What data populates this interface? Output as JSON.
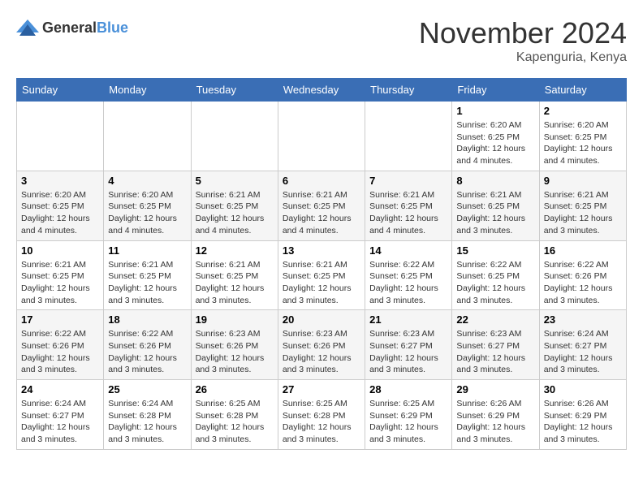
{
  "logo": {
    "general": "General",
    "blue": "Blue"
  },
  "header": {
    "month": "November 2024",
    "location": "Kapenguria, Kenya"
  },
  "weekdays": [
    "Sunday",
    "Monday",
    "Tuesday",
    "Wednesday",
    "Thursday",
    "Friday",
    "Saturday"
  ],
  "weeks": [
    [
      {
        "day": "",
        "info": ""
      },
      {
        "day": "",
        "info": ""
      },
      {
        "day": "",
        "info": ""
      },
      {
        "day": "",
        "info": ""
      },
      {
        "day": "",
        "info": ""
      },
      {
        "day": "1",
        "info": "Sunrise: 6:20 AM\nSunset: 6:25 PM\nDaylight: 12 hours and 4 minutes."
      },
      {
        "day": "2",
        "info": "Sunrise: 6:20 AM\nSunset: 6:25 PM\nDaylight: 12 hours and 4 minutes."
      }
    ],
    [
      {
        "day": "3",
        "info": "Sunrise: 6:20 AM\nSunset: 6:25 PM\nDaylight: 12 hours and 4 minutes."
      },
      {
        "day": "4",
        "info": "Sunrise: 6:20 AM\nSunset: 6:25 PM\nDaylight: 12 hours and 4 minutes."
      },
      {
        "day": "5",
        "info": "Sunrise: 6:21 AM\nSunset: 6:25 PM\nDaylight: 12 hours and 4 minutes."
      },
      {
        "day": "6",
        "info": "Sunrise: 6:21 AM\nSunset: 6:25 PM\nDaylight: 12 hours and 4 minutes."
      },
      {
        "day": "7",
        "info": "Sunrise: 6:21 AM\nSunset: 6:25 PM\nDaylight: 12 hours and 4 minutes."
      },
      {
        "day": "8",
        "info": "Sunrise: 6:21 AM\nSunset: 6:25 PM\nDaylight: 12 hours and 3 minutes."
      },
      {
        "day": "9",
        "info": "Sunrise: 6:21 AM\nSunset: 6:25 PM\nDaylight: 12 hours and 3 minutes."
      }
    ],
    [
      {
        "day": "10",
        "info": "Sunrise: 6:21 AM\nSunset: 6:25 PM\nDaylight: 12 hours and 3 minutes."
      },
      {
        "day": "11",
        "info": "Sunrise: 6:21 AM\nSunset: 6:25 PM\nDaylight: 12 hours and 3 minutes."
      },
      {
        "day": "12",
        "info": "Sunrise: 6:21 AM\nSunset: 6:25 PM\nDaylight: 12 hours and 3 minutes."
      },
      {
        "day": "13",
        "info": "Sunrise: 6:21 AM\nSunset: 6:25 PM\nDaylight: 12 hours and 3 minutes."
      },
      {
        "day": "14",
        "info": "Sunrise: 6:22 AM\nSunset: 6:25 PM\nDaylight: 12 hours and 3 minutes."
      },
      {
        "day": "15",
        "info": "Sunrise: 6:22 AM\nSunset: 6:25 PM\nDaylight: 12 hours and 3 minutes."
      },
      {
        "day": "16",
        "info": "Sunrise: 6:22 AM\nSunset: 6:26 PM\nDaylight: 12 hours and 3 minutes."
      }
    ],
    [
      {
        "day": "17",
        "info": "Sunrise: 6:22 AM\nSunset: 6:26 PM\nDaylight: 12 hours and 3 minutes."
      },
      {
        "day": "18",
        "info": "Sunrise: 6:22 AM\nSunset: 6:26 PM\nDaylight: 12 hours and 3 minutes."
      },
      {
        "day": "19",
        "info": "Sunrise: 6:23 AM\nSunset: 6:26 PM\nDaylight: 12 hours and 3 minutes."
      },
      {
        "day": "20",
        "info": "Sunrise: 6:23 AM\nSunset: 6:26 PM\nDaylight: 12 hours and 3 minutes."
      },
      {
        "day": "21",
        "info": "Sunrise: 6:23 AM\nSunset: 6:27 PM\nDaylight: 12 hours and 3 minutes."
      },
      {
        "day": "22",
        "info": "Sunrise: 6:23 AM\nSunset: 6:27 PM\nDaylight: 12 hours and 3 minutes."
      },
      {
        "day": "23",
        "info": "Sunrise: 6:24 AM\nSunset: 6:27 PM\nDaylight: 12 hours and 3 minutes."
      }
    ],
    [
      {
        "day": "24",
        "info": "Sunrise: 6:24 AM\nSunset: 6:27 PM\nDaylight: 12 hours and 3 minutes."
      },
      {
        "day": "25",
        "info": "Sunrise: 6:24 AM\nSunset: 6:28 PM\nDaylight: 12 hours and 3 minutes."
      },
      {
        "day": "26",
        "info": "Sunrise: 6:25 AM\nSunset: 6:28 PM\nDaylight: 12 hours and 3 minutes."
      },
      {
        "day": "27",
        "info": "Sunrise: 6:25 AM\nSunset: 6:28 PM\nDaylight: 12 hours and 3 minutes."
      },
      {
        "day": "28",
        "info": "Sunrise: 6:25 AM\nSunset: 6:29 PM\nDaylight: 12 hours and 3 minutes."
      },
      {
        "day": "29",
        "info": "Sunrise: 6:26 AM\nSunset: 6:29 PM\nDaylight: 12 hours and 3 minutes."
      },
      {
        "day": "30",
        "info": "Sunrise: 6:26 AM\nSunset: 6:29 PM\nDaylight: 12 hours and 3 minutes."
      }
    ]
  ]
}
